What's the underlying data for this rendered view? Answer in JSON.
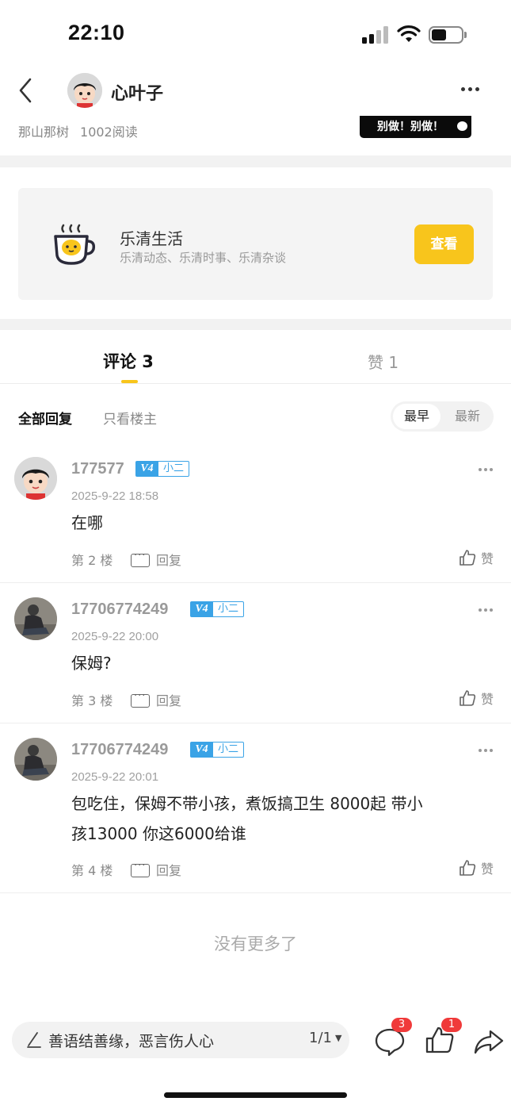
{
  "status_bar": {
    "time": "22:10"
  },
  "header": {
    "author_name": "心叶子",
    "circle_name": "那山那树",
    "read_count": "1002阅读",
    "banner_text": "别做！别做！"
  },
  "circle_card": {
    "title": "乐清生活",
    "description": "乐清动态、乐清时事、乐清杂谈",
    "button_label": "查看"
  },
  "tabs": {
    "comments": "评论 3",
    "likes": "赞 1"
  },
  "filters": {
    "all": "全部回复",
    "op_only": "只看楼主",
    "sort_earliest": "最早",
    "sort_latest": "最新"
  },
  "comments": [
    {
      "user": "177577",
      "level": "V4",
      "role": "小二",
      "time": "2025-9-22 18:58",
      "text": "在哪",
      "floor": "第 2 楼",
      "reply_label": "回复",
      "like_label": "赞"
    },
    {
      "user": "17706774249",
      "level": "V4",
      "role": "小二",
      "time": "2025-9-22 20:00",
      "text": "保姆?",
      "floor": "第 3 楼",
      "reply_label": "回复",
      "like_label": "赞"
    },
    {
      "user": "17706774249",
      "level": "V4",
      "role": "小二",
      "time": "2025-9-22 20:01",
      "text_line1": "包吃住，保姆不带小孩，煮饭搞卫生 8000起  带小",
      "text_line2": "孩13000  你这6000给谁",
      "floor": "第 4 楼",
      "reply_label": "回复",
      "like_label": "赞"
    }
  ],
  "no_more": "没有更多了",
  "bottom_bar": {
    "input_placeholder": "善语结善缘，恶言伤人心",
    "page_indicator": "1/1",
    "comment_count": "3",
    "like_count": "1"
  },
  "colors": {
    "accent": "#f8c51c",
    "badge_blue": "#3aa3e6",
    "badge_red": "#f03a3a"
  }
}
